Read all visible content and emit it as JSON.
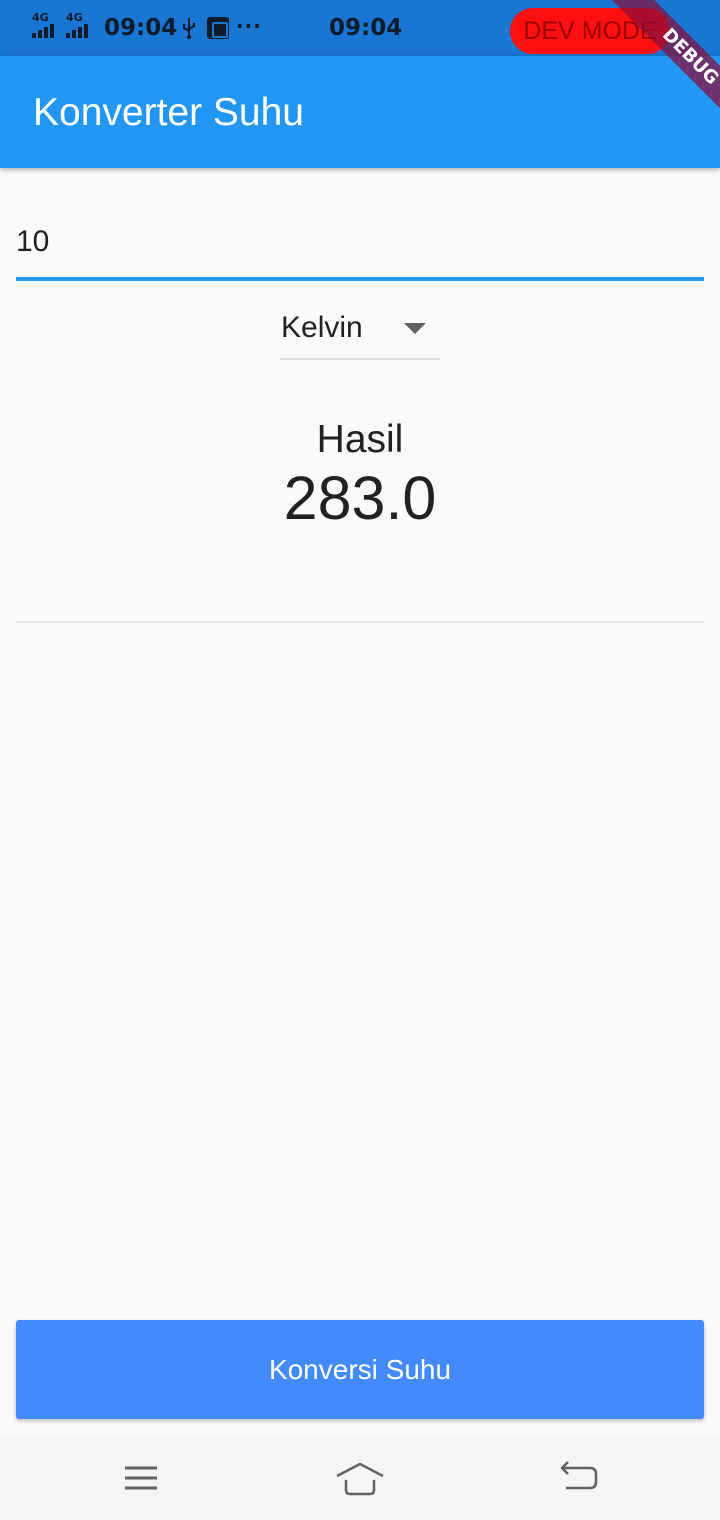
{
  "status_bar": {
    "signal1_label": "4G",
    "signal2_label": "4G",
    "time_left": "09:04",
    "more": "···",
    "time_center": "09:04",
    "dev_mode": "DEV MODE"
  },
  "debug_banner": "DEBUG",
  "app_bar": {
    "title": "Konverter Suhu"
  },
  "input": {
    "value": "10"
  },
  "dropdown": {
    "selected": "Kelvin"
  },
  "result": {
    "label": "Hasil",
    "value": "283.0"
  },
  "button": {
    "label": "Konversi Suhu"
  },
  "nav": {
    "icons": [
      "menu-icon",
      "home-icon",
      "back-icon"
    ]
  },
  "colors": {
    "status_bar": "#1976d2",
    "app_bar": "#2196f3",
    "accent": "#2196f3",
    "button": "#448aff",
    "dev_mode": "#ff1010"
  }
}
